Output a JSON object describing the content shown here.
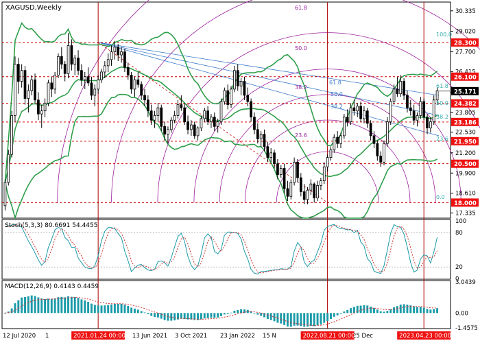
{
  "chart_data": {
    "type": "candlestick",
    "symbol_label": "XAGUSD,Weekly",
    "timeframe": "Weekly",
    "price_axis": {
      "ylim": [
        17.0,
        30.9
      ],
      "tick_labels": [
        "30.335",
        "29.020",
        "27.700",
        "26.415",
        "25.100",
        "23.805",
        "22.530",
        "21.200",
        "19.900",
        "18.610",
        "17.335"
      ]
    },
    "time_axis": {
      "tick_labels": [
        "12 Jul 2020",
        "1",
        "13 Jun 2021",
        "3 Oct 2021",
        "23 Jan 2022",
        "15 N",
        "2022",
        "25 Dec",
        "3"
      ],
      "highlighted_labels": [
        "2021.01.24 00:00",
        "2022.08.21 00:00",
        "2023.04.23 00:00"
      ]
    },
    "levels": [
      {
        "price": 28.3,
        "label": "28.300"
      },
      {
        "price": 26.1,
        "label": "26.100"
      },
      {
        "price": 24.382,
        "label": "24.382"
      },
      {
        "price": 23.186,
        "label": "23.186"
      },
      {
        "price": 21.95,
        "label": "21.950"
      },
      {
        "price": 20.5,
        "label": "20.500"
      },
      {
        "price": 18.0,
        "label": "18.000"
      }
    ],
    "current_price": {
      "price": 25.171,
      "label": "25.171"
    },
    "vertical_markers": [
      {
        "label": "2021.01.24 00:00"
      },
      {
        "label": "2022.08.21 00:00"
      },
      {
        "label": "2023.04.23 00:00"
      }
    ],
    "fib_retracement": [
      {
        "label": "100.0",
        "price": 28.6
      },
      {
        "label": "61.8",
        "price": 25.3
      },
      {
        "label": "50.0",
        "price": 24.2
      },
      {
        "label": "38.2",
        "price": 23.3
      },
      {
        "label": "23.6",
        "price": 21.9
      },
      {
        "label": "0.0",
        "price": 18.15
      }
    ],
    "fib_fan_labels": [
      {
        "label": "61.8"
      },
      {
        "label": "50.0"
      },
      {
        "label": "38.2"
      }
    ],
    "fib_arc_labels": [
      "61.8",
      "50.0",
      "38.2",
      "23.6"
    ],
    "candles": [
      [
        17.8,
        19.5,
        17.5,
        19.3
      ],
      [
        19.3,
        21.4,
        19.1,
        21.1
      ],
      [
        21.1,
        23.9,
        20.9,
        23.6
      ],
      [
        23.6,
        27.4,
        23.2,
        26.9
      ],
      [
        26.9,
        27.3,
        25.0,
        25.8
      ],
      [
        25.8,
        26.9,
        25.4,
        26.5
      ],
      [
        26.5,
        26.8,
        24.3,
        24.7
      ],
      [
        24.7,
        25.6,
        23.8,
        25.2
      ],
      [
        25.2,
        26.2,
        24.9,
        25.9
      ],
      [
        25.9,
        26.3,
        24.4,
        24.6
      ],
      [
        24.6,
        25.1,
        23.3,
        23.7
      ],
      [
        23.7,
        24.3,
        22.8,
        23.9
      ],
      [
        23.9,
        24.7,
        23.5,
        24.4
      ],
      [
        24.4,
        25.9,
        24.2,
        25.7
      ],
      [
        25.7,
        26.1,
        24.8,
        25.3
      ],
      [
        25.3,
        26.4,
        25.0,
        26.2
      ],
      [
        26.2,
        27.6,
        26.0,
        27.4
      ],
      [
        27.4,
        28.0,
        26.6,
        26.9
      ],
      [
        26.9,
        27.1,
        25.8,
        26.3
      ],
      [
        26.3,
        28.9,
        26.0,
        28.1
      ],
      [
        28.1,
        28.5,
        26.5,
        26.9
      ],
      [
        26.9,
        27.5,
        26.2,
        27.3
      ],
      [
        27.3,
        27.8,
        26.2,
        26.5
      ],
      [
        26.5,
        26.9,
        25.5,
        25.9
      ],
      [
        25.9,
        26.4,
        25.3,
        26.1
      ],
      [
        26.1,
        26.7,
        25.5,
        25.7
      ],
      [
        25.7,
        26.1,
        24.6,
        24.9
      ],
      [
        24.9,
        25.6,
        24.2,
        25.3
      ],
      [
        25.3,
        26.2,
        25.0,
        25.9
      ],
      [
        25.9,
        26.6,
        25.7,
        26.4
      ],
      [
        26.4,
        27.1,
        26.0,
        26.8
      ],
      [
        26.8,
        27.6,
        26.4,
        27.2
      ],
      [
        27.2,
        28.1,
        26.8,
        27.7
      ],
      [
        27.7,
        28.4,
        27.2,
        28.0
      ],
      [
        28.0,
        28.2,
        27.1,
        27.5
      ],
      [
        27.5,
        28.0,
        27.0,
        27.7
      ],
      [
        27.7,
        27.9,
        26.4,
        26.7
      ],
      [
        26.7,
        27.0,
        25.9,
        26.2
      ],
      [
        26.2,
        26.4,
        25.0,
        25.3
      ],
      [
        25.3,
        26.1,
        24.8,
        25.9
      ],
      [
        25.9,
        26.4,
        25.4,
        25.6
      ],
      [
        25.6,
        25.8,
        24.6,
        24.9
      ],
      [
        24.9,
        25.3,
        24.2,
        24.6
      ],
      [
        24.6,
        24.9,
        23.5,
        23.9
      ],
      [
        23.9,
        24.3,
        23.0,
        23.3
      ],
      [
        23.3,
        23.9,
        22.8,
        23.6
      ],
      [
        23.6,
        24.4,
        23.2,
        24.1
      ],
      [
        24.1,
        24.3,
        22.6,
        22.9
      ],
      [
        22.9,
        23.2,
        22.0,
        22.4
      ],
      [
        22.4,
        22.9,
        21.8,
        22.7
      ],
      [
        22.7,
        23.5,
        22.5,
        23.3
      ],
      [
        23.3,
        23.9,
        23.1,
        23.6
      ],
      [
        23.6,
        24.6,
        23.4,
        24.3
      ],
      [
        24.3,
        24.9,
        23.9,
        24.1
      ],
      [
        24.1,
        24.4,
        23.0,
        23.2
      ],
      [
        23.2,
        23.6,
        22.4,
        22.7
      ],
      [
        22.7,
        23.3,
        22.3,
        23.0
      ],
      [
        23.0,
        23.2,
        22.1,
        22.3
      ],
      [
        22.3,
        22.9,
        22.0,
        22.8
      ],
      [
        22.8,
        23.6,
        22.6,
        23.4
      ],
      [
        23.4,
        24.1,
        23.2,
        23.9
      ],
      [
        23.9,
        24.2,
        23.0,
        23.2
      ],
      [
        23.2,
        23.7,
        22.8,
        23.5
      ],
      [
        23.5,
        23.8,
        22.6,
        22.9
      ],
      [
        22.9,
        23.4,
        22.5,
        23.2
      ],
      [
        23.2,
        24.7,
        23.0,
        24.5
      ],
      [
        24.5,
        25.4,
        24.3,
        25.2
      ],
      [
        25.2,
        25.6,
        24.0,
        24.3
      ],
      [
        24.3,
        25.5,
        24.1,
        25.3
      ],
      [
        25.3,
        26.8,
        25.1,
        26.5
      ],
      [
        26.5,
        26.9,
        25.2,
        25.5
      ],
      [
        25.5,
        26.0,
        24.9,
        25.8
      ],
      [
        25.8,
        26.1,
        24.6,
        24.9
      ],
      [
        24.9,
        25.4,
        24.2,
        24.5
      ],
      [
        24.5,
        24.7,
        23.2,
        23.5
      ],
      [
        23.5,
        23.8,
        22.4,
        22.7
      ],
      [
        22.7,
        23.1,
        21.8,
        22.1
      ],
      [
        22.1,
        22.6,
        21.6,
        22.4
      ],
      [
        22.4,
        22.7,
        21.3,
        21.6
      ],
      [
        21.6,
        21.9,
        20.6,
        20.9
      ],
      [
        20.9,
        21.5,
        20.6,
        21.2
      ],
      [
        21.2,
        21.4,
        20.2,
        20.5
      ],
      [
        20.5,
        20.8,
        19.5,
        19.8
      ],
      [
        19.8,
        20.4,
        19.6,
        20.2
      ],
      [
        20.2,
        20.5,
        18.6,
        18.9
      ],
      [
        18.9,
        19.4,
        18.1,
        18.4
      ],
      [
        18.4,
        19.5,
        18.2,
        19.3
      ],
      [
        19.3,
        20.9,
        19.1,
        20.6
      ],
      [
        20.6,
        20.8,
        19.3,
        19.6
      ],
      [
        19.6,
        19.9,
        18.4,
        18.7
      ],
      [
        18.7,
        19.2,
        17.9,
        18.2
      ],
      [
        18.2,
        19.0,
        17.9,
        18.8
      ],
      [
        18.8,
        19.5,
        18.5,
        19.2
      ],
      [
        19.2,
        19.3,
        18.0,
        18.3
      ],
      [
        18.3,
        19.4,
        18.1,
        19.1
      ],
      [
        19.1,
        19.6,
        18.8,
        19.4
      ],
      [
        19.4,
        20.6,
        19.2,
        20.3
      ],
      [
        20.3,
        21.1,
        20.0,
        20.9
      ],
      [
        20.9,
        21.6,
        20.7,
        21.4
      ],
      [
        21.4,
        22.4,
        21.2,
        22.2
      ],
      [
        22.2,
        22.6,
        21.5,
        21.8
      ],
      [
        21.8,
        22.5,
        21.5,
        22.3
      ],
      [
        22.3,
        23.7,
        22.1,
        23.5
      ],
      [
        23.5,
        24.0,
        22.9,
        23.2
      ],
      [
        23.2,
        24.4,
        23.0,
        24.1
      ],
      [
        24.1,
        24.6,
        23.6,
        23.9
      ],
      [
        23.9,
        24.4,
        23.5,
        24.2
      ],
      [
        24.2,
        24.5,
        23.2,
        23.4
      ],
      [
        23.4,
        24.2,
        23.1,
        23.9
      ],
      [
        23.9,
        24.1,
        22.8,
        23.1
      ],
      [
        23.1,
        23.3,
        22.0,
        22.3
      ],
      [
        22.3,
        22.6,
        21.5,
        21.8
      ],
      [
        21.8,
        22.0,
        20.7,
        21.0
      ],
      [
        21.0,
        21.3,
        20.3,
        20.6
      ],
      [
        20.6,
        22.0,
        20.4,
        21.8
      ],
      [
        21.8,
        23.5,
        21.6,
        23.2
      ],
      [
        23.2,
        24.7,
        23.0,
        24.5
      ],
      [
        24.5,
        25.6,
        24.3,
        25.3
      ],
      [
        25.3,
        26.1,
        24.8,
        25.0
      ],
      [
        25.0,
        26.2,
        24.8,
        25.8
      ],
      [
        25.8,
        26.0,
        24.6,
        24.9
      ],
      [
        24.9,
        25.2,
        23.8,
        24.1
      ],
      [
        24.1,
        24.6,
        23.6,
        23.9
      ],
      [
        23.9,
        24.3,
        23.0,
        23.3
      ],
      [
        23.3,
        23.8,
        22.9,
        23.6
      ],
      [
        23.6,
        24.8,
        23.4,
        24.5
      ],
      [
        24.5,
        24.7,
        23.3,
        23.5
      ],
      [
        23.5,
        23.7,
        22.4,
        22.8
      ],
      [
        22.8,
        23.5,
        22.5,
        23.2
      ],
      [
        23.2,
        24.9,
        23.0,
        24.6
      ],
      [
        24.6,
        25.4,
        24.3,
        25.2
      ]
    ],
    "stochastic": {
      "title": "Stoch(5,3,3) 80.6691 54.4455",
      "ylim": [
        0,
        100
      ],
      "tick_labels": [
        "100",
        "80",
        "20",
        "0"
      ]
    },
    "macd": {
      "title": "MACD(12,26,9) 0.4143 0.4459",
      "tick_labels": [
        "3.0439",
        "0.00",
        "-1.4575"
      ]
    }
  }
}
